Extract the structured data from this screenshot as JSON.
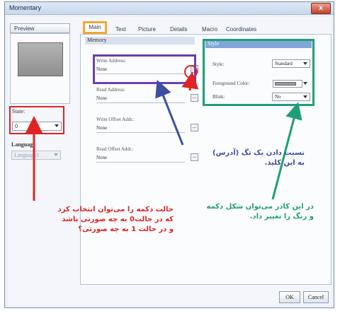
{
  "window": {
    "title": "Momentary",
    "close_label": "x"
  },
  "preview": {
    "tab_label": "Preview"
  },
  "left": {
    "state_label": "State:",
    "state_value": "0",
    "language_label": "Language",
    "language_value": "Language1"
  },
  "tabs": [
    "Main",
    "Text",
    "Picture",
    "Details",
    "Macro",
    "Coordinates"
  ],
  "memory": {
    "header": "Memory",
    "fields": [
      {
        "label": "Write Address:",
        "value": "None",
        "button": "..."
      },
      {
        "label": "Read Address:",
        "value": "None",
        "button": "..."
      },
      {
        "label": "Write Offset Addr.:",
        "value": "None",
        "button": "..."
      },
      {
        "label": "Read Offset Addr.:",
        "value": "None",
        "button": "..."
      }
    ]
  },
  "style": {
    "header": "Style",
    "style_label": "Style:",
    "style_value": "Standard",
    "fg_label": "Foreground Color:",
    "blink_label": "Blink:",
    "blink_value": "No"
  },
  "annotations": {
    "purple_line1": "نسبت دادن یک تگ (آدرس)",
    "purple_line2": "به این کلید.",
    "green_line1": "در این کادر می‌توان شکل دکمه",
    "green_line2": "و رنگ را تغییر داد.",
    "red_line1": "حالت دکمه را می‌توان انتخاب کرد",
    "red_line2": "که در حالت0 به چه صورتی باشد",
    "red_line3": "و در حالت 1 به چه صورتی؟"
  },
  "buttons": {
    "ok": "OK",
    "cancel": "Cancel"
  },
  "colors": {
    "red": "#e02424",
    "purple": "#6a3fb0",
    "green": "#1f9e7a",
    "orange": "#f0a830",
    "blue_annotation": "#3d4fa0"
  }
}
